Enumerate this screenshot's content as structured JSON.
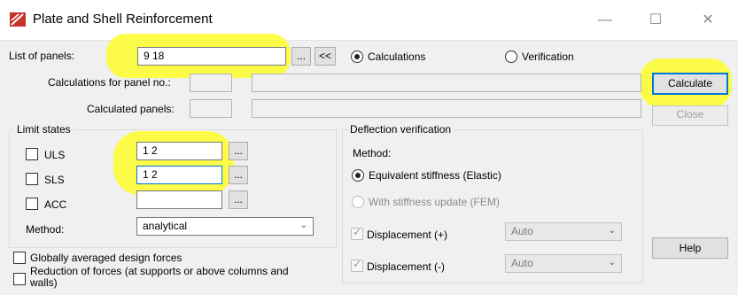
{
  "window": {
    "title": "Plate and Shell Reinforcement",
    "minimize": "—",
    "maximize": "☐",
    "close": "✕"
  },
  "top": {
    "list_label": "List of panels:",
    "list_value": "9 18",
    "browse_label": "...",
    "back_label": "<<",
    "calc_radio": "Calculations",
    "verif_radio": "Verification",
    "panel_no_label": "Calculations for panel no.:",
    "calculated_label": "Calculated panels:"
  },
  "buttons": {
    "calculate": "Calculate",
    "close": "Close",
    "help": "Help"
  },
  "limit_states": {
    "title": "Limit states",
    "uls_label": "ULS",
    "uls_value": "1 2",
    "sls_label": "SLS",
    "sls_value": "1 2",
    "acc_label": "ACC",
    "acc_value": "",
    "browse": "...",
    "method_label": "Method:",
    "method_value": "analytical"
  },
  "deflection": {
    "title": "Deflection verification",
    "method_label": "Method:",
    "opt1": "Equivalent stiffness (Elastic)",
    "opt2": "With stiffness update (FEM)",
    "disp_plus": "Displacement (+)",
    "disp_minus": "Displacement (-)",
    "auto1": "Auto",
    "auto2": "Auto"
  },
  "bottom": {
    "global_avg": "Globally averaged design forces",
    "reduction": "Reduction of forces (at supports or above columns and walls)"
  },
  "colors": {
    "highlight": "#fdfd2a",
    "focus_border": "#0078d7"
  }
}
